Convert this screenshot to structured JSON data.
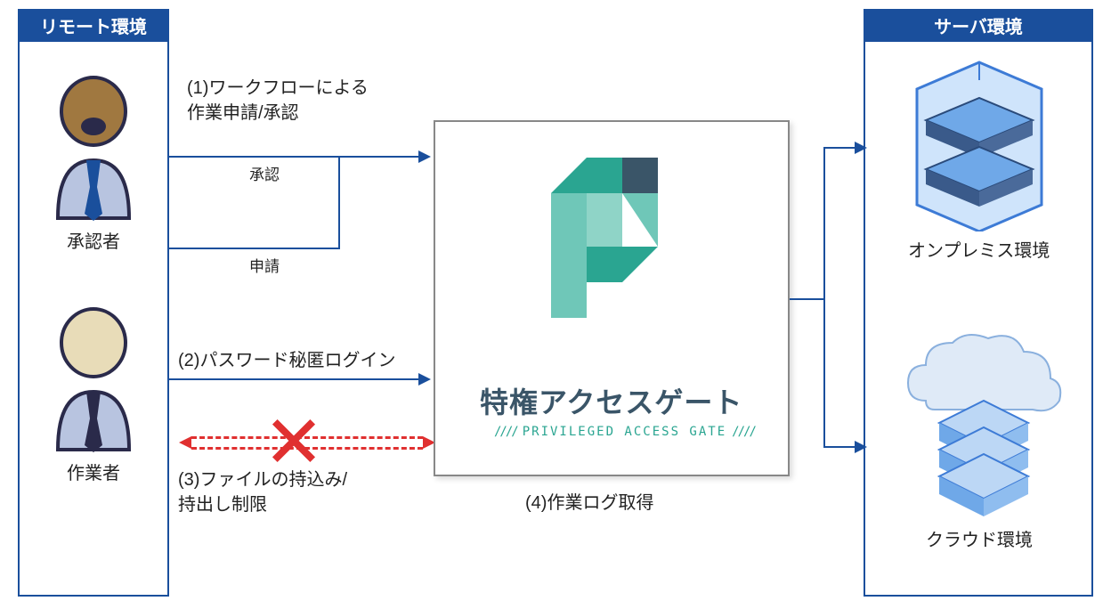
{
  "remote_panel": {
    "title": "リモート環境"
  },
  "server_panel": {
    "title": "サーバ環境"
  },
  "approver_label": "承認者",
  "worker_label": "作業者",
  "step1_title": "(1)ワークフローによる\n作業申請/承認",
  "step1_approve": "承認",
  "step1_request": "申請",
  "step2_title": "(2)パスワード秘匿ログイン",
  "step3_title": "(3)ファイルの持込み/\n持出し制限",
  "step4_title": "(4)作業ログ取得",
  "product": {
    "name": "特権アクセスゲート",
    "subtitle": "PRIVILEGED ACCESS GATE"
  },
  "onprem_label": "オンプレミス環境",
  "cloud_label": "クラウド環境",
  "colors": {
    "primary": "#1a4f9c",
    "teal": "#2aa591",
    "teal_light": "#6fc7b8",
    "red": "#e03030",
    "blue_light": "#6fa8e8",
    "blue_mid": "#3d7bd6"
  }
}
